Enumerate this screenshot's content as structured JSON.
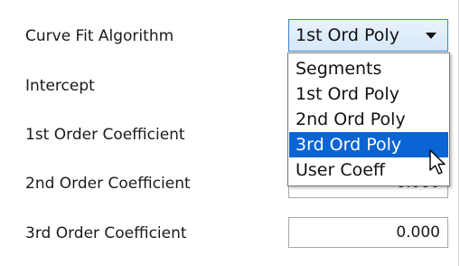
{
  "curve_fit": {
    "label": "Curve Fit Algorithm",
    "selected_value": "1st Ord Poly",
    "options": [
      "Segments",
      "1st Ord Poly",
      "2nd Ord Poly",
      "3rd Ord Poly",
      "User Coeff"
    ],
    "highlighted_option": "3rd Ord Poly"
  },
  "fields": [
    {
      "label": "Intercept",
      "value": ""
    },
    {
      "label": "1st Order Coefficient",
      "value": ""
    },
    {
      "label": "2nd Order Coefficient",
      "value": "0.000"
    },
    {
      "label": "3rd Order Coefficient",
      "value": "0.000"
    }
  ],
  "colors": {
    "selection": "#0a64d4",
    "combo_border": "#3c7fd6"
  },
  "icons": {
    "combo_arrow": "chevron-down-icon",
    "pointer": "mouse-pointer-icon"
  }
}
